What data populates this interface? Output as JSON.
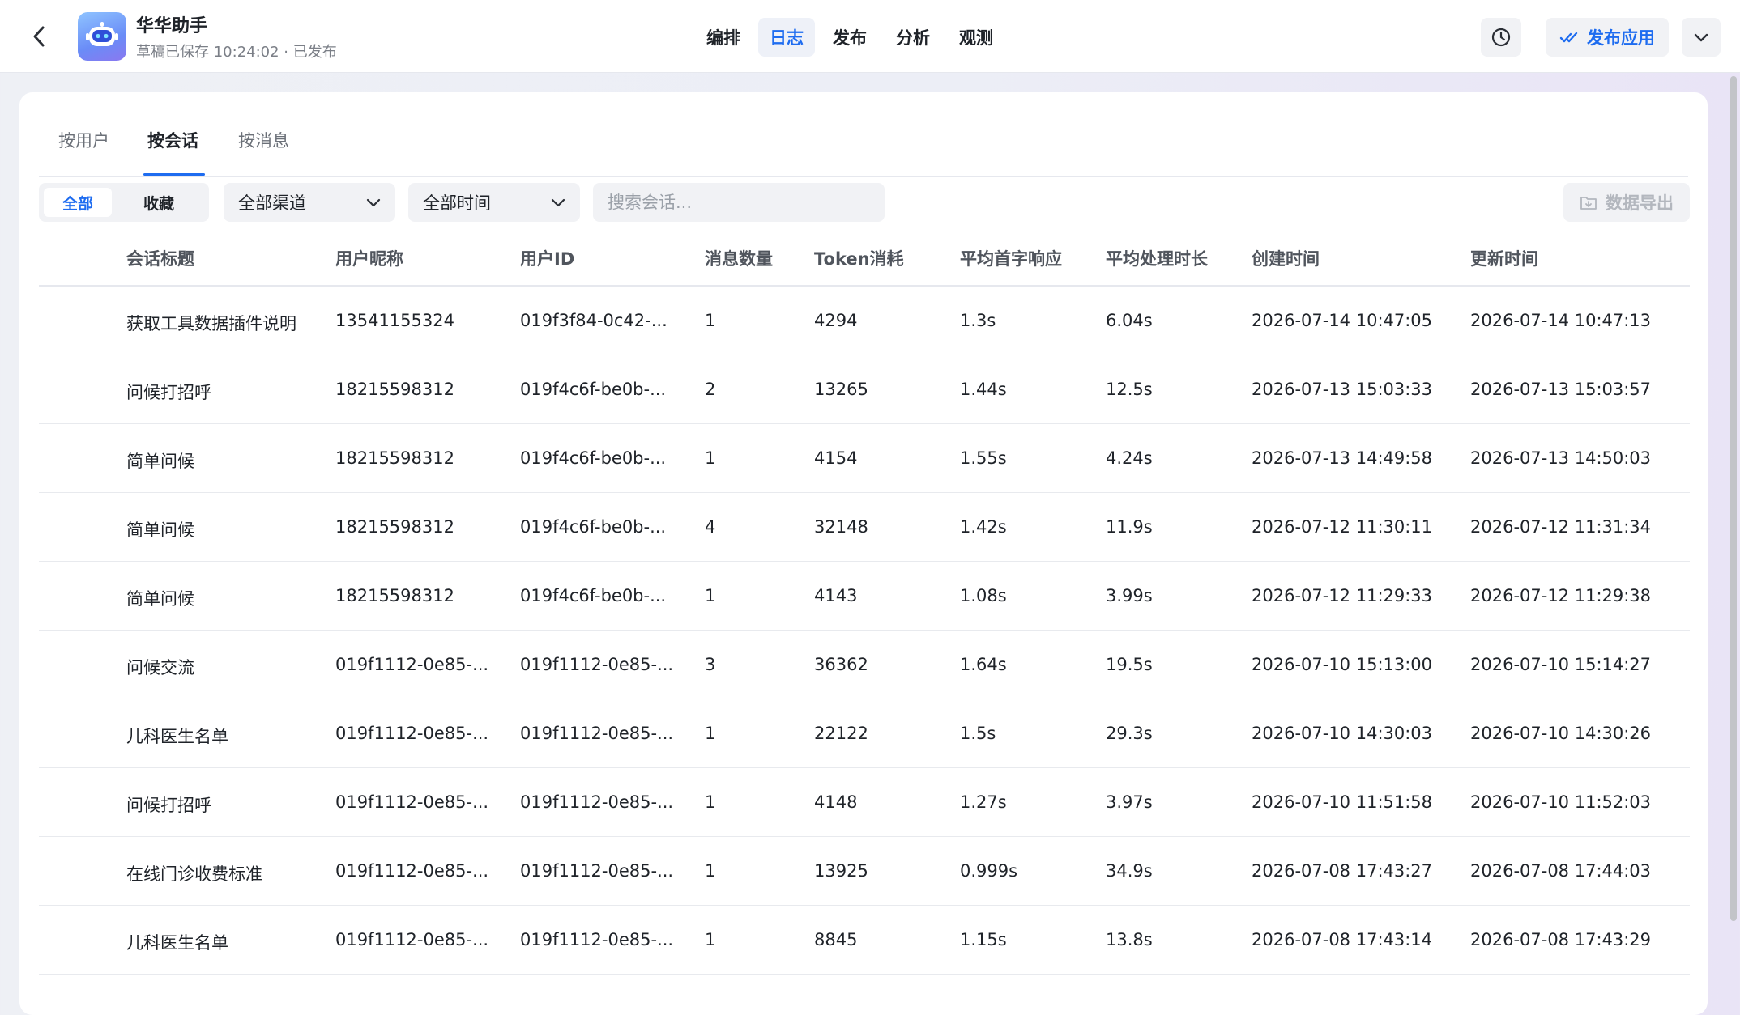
{
  "app": {
    "name": "华华助手",
    "status": "草稿已保存 10:24:02 · 已发布"
  },
  "nav": {
    "tabs": [
      {
        "label": "编排",
        "active": false
      },
      {
        "label": "日志",
        "active": true
      },
      {
        "label": "发布",
        "active": false
      },
      {
        "label": "分析",
        "active": false
      },
      {
        "label": "观测",
        "active": false
      }
    ]
  },
  "actions": {
    "publish_label": "发布应用"
  },
  "subtabs": [
    "按用户",
    "按会话",
    "按消息"
  ],
  "filters": {
    "segment_all": "全部",
    "segment_fav": "收藏",
    "channel": "全部渠道",
    "time": "全部时间",
    "search_placeholder": "搜索会话...",
    "export_label": "数据导出"
  },
  "table": {
    "columns": [
      "会话标题",
      "用户昵称",
      "用户ID",
      "消息数量",
      "Token消耗",
      "平均首字响应",
      "平均处理时长",
      "创建时间",
      "更新时间"
    ],
    "rows": [
      [
        "获取工具数据插件说明",
        "13541155324",
        "019f3f84-0c42-...",
        "1",
        "4294",
        "1.3s",
        "6.04s",
        "2026-07-14 10:47:05",
        "2026-07-14 10:47:13"
      ],
      [
        "问候打招呼",
        "18215598312",
        "019f4c6f-be0b-...",
        "2",
        "13265",
        "1.44s",
        "12.5s",
        "2026-07-13 15:03:33",
        "2026-07-13 15:03:57"
      ],
      [
        "简单问候",
        "18215598312",
        "019f4c6f-be0b-...",
        "1",
        "4154",
        "1.55s",
        "4.24s",
        "2026-07-13 14:49:58",
        "2026-07-13 14:50:03"
      ],
      [
        "简单问候",
        "18215598312",
        "019f4c6f-be0b-...",
        "4",
        "32148",
        "1.42s",
        "11.9s",
        "2026-07-12 11:30:11",
        "2026-07-12 11:31:34"
      ],
      [
        "简单问候",
        "18215598312",
        "019f4c6f-be0b-...",
        "1",
        "4143",
        "1.08s",
        "3.99s",
        "2026-07-12 11:29:33",
        "2026-07-12 11:29:38"
      ],
      [
        "问候交流",
        "019f1112-0e85-...",
        "019f1112-0e85-...",
        "3",
        "36362",
        "1.64s",
        "19.5s",
        "2026-07-10 15:13:00",
        "2026-07-10 15:14:27"
      ],
      [
        "儿科医生名单",
        "019f1112-0e85-...",
        "019f1112-0e85-...",
        "1",
        "22122",
        "1.5s",
        "29.3s",
        "2026-07-10 14:30:03",
        "2026-07-10 14:30:26"
      ],
      [
        "问候打招呼",
        "019f1112-0e85-...",
        "019f1112-0e85-...",
        "1",
        "4148",
        "1.27s",
        "3.97s",
        "2026-07-10 11:51:58",
        "2026-07-10 11:52:03"
      ],
      [
        "在线门诊收费标准",
        "019f1112-0e85-...",
        "019f1112-0e85-...",
        "1",
        "13925",
        "0.999s",
        "34.9s",
        "2026-07-08 17:43:27",
        "2026-07-08 17:44:03"
      ],
      [
        "儿科医生名单",
        "019f1112-0e85-...",
        "019f1112-0e85-...",
        "1",
        "8845",
        "1.15s",
        "13.8s",
        "2026-07-08 17:43:14",
        "2026-07-08 17:43:29"
      ]
    ]
  },
  "colors": {
    "accent": "#1e6cf0",
    "text": "#1f2329",
    "muted": "#7b7f87"
  }
}
